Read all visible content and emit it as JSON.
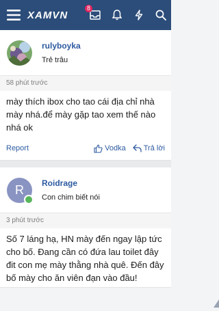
{
  "header": {
    "logo": "XAMVN",
    "inbox_badge": "8",
    "icons": [
      "menu-icon",
      "inbox-icon",
      "bell-icon",
      "lightning-icon",
      "search-icon"
    ]
  },
  "posts": [
    {
      "username": "rulyboyka",
      "user_title": "Trẻ trâu",
      "time": "58 phút trước",
      "body": "mày thích ibox cho tao cái địa chỉ nhà mày nhá.để mày gặp tao xem thế nào nhá ok",
      "report": "Report",
      "like": "Vodka",
      "reply": "Trả lời"
    },
    {
      "avatar_letter": "R",
      "username": "Roidrage",
      "user_title": "Con chim biết nói",
      "time": "3 phút trước",
      "body": "Số 7 láng hạ, HN mày đến ngay lập tức cho bố. Đang cần có đứa lau toilet đây đit con mẹ mày thằng nhà quê. Đến đây bố mày cho ăn viên đạn vào đầu!"
    }
  ],
  "colors": {
    "header_bg": "#2c4d7a",
    "link": "#2c5aa0",
    "badge": "#e0245e",
    "online": "#58b75b"
  }
}
